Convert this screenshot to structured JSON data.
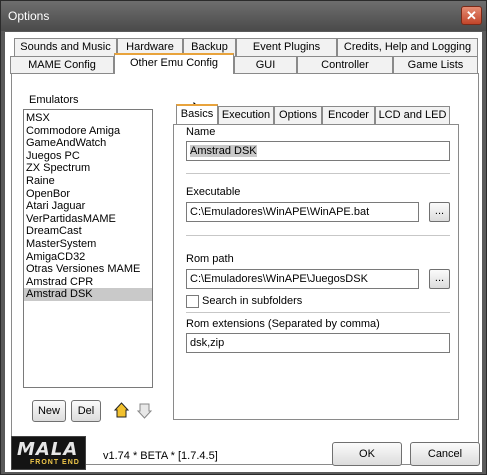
{
  "window": {
    "title": "Options",
    "close_label": "✕"
  },
  "top_tabs_row1": [
    {
      "label": "Sounds and Music"
    },
    {
      "label": "Hardware"
    },
    {
      "label": "Backup"
    },
    {
      "label": "Event Plugins"
    },
    {
      "label": "Credits, Help and Logging"
    }
  ],
  "top_tabs_row2": [
    {
      "label": "MAME Config"
    },
    {
      "label": "Other Emu Config"
    },
    {
      "label": "GUI"
    },
    {
      "label": "Controller"
    },
    {
      "label": "Game Lists"
    }
  ],
  "emulators": {
    "label": "Emulators",
    "items": [
      "MSX",
      "Commodore Amiga",
      "GameAndWatch",
      "Juegos PC",
      "ZX Spectrum",
      "Raine",
      "OpenBor",
      "Atari Jaguar",
      "VerPartidasMAME",
      "DreamCast",
      "MasterSystem",
      "AmigaCD32",
      "Otras Versiones MAME",
      "Amstrad CPR",
      "Amstrad DSK"
    ],
    "selected": "Amstrad DSK",
    "new_label": "New",
    "del_label": "Del"
  },
  "inner_tabs": [
    {
      "label": "Basics"
    },
    {
      "label": "Execution"
    },
    {
      "label": "Options"
    },
    {
      "label": "Encoder"
    },
    {
      "label": "LCD and LED"
    }
  ],
  "basics": {
    "name_label": "Name",
    "name_value": "Amstrad DSK",
    "executable_label": "Executable",
    "executable_value": "C:\\Emuladores\\WinAPE\\WinAPE.bat",
    "rompath_label": "Rom path",
    "rompath_value": "C:\\Emuladores\\WinAPE\\JuegosDSK",
    "browse_label": "...",
    "search_subfolders_label": "Search in subfolders",
    "search_subfolders_checked": false,
    "rom_ext_label": "Rom extensions (Separated by comma)",
    "rom_ext_value": "dsk,zip"
  },
  "footer": {
    "logo_text": "MALA",
    "logo_sub": "FRONT END",
    "version": "v1.74  * BETA * [1.7.4.5]",
    "ok_label": "OK",
    "cancel_label": "Cancel"
  },
  "colors": {
    "accent_tab": "#e8a33c",
    "close_button": "#c2452a",
    "selection": "#c9c9c9"
  }
}
